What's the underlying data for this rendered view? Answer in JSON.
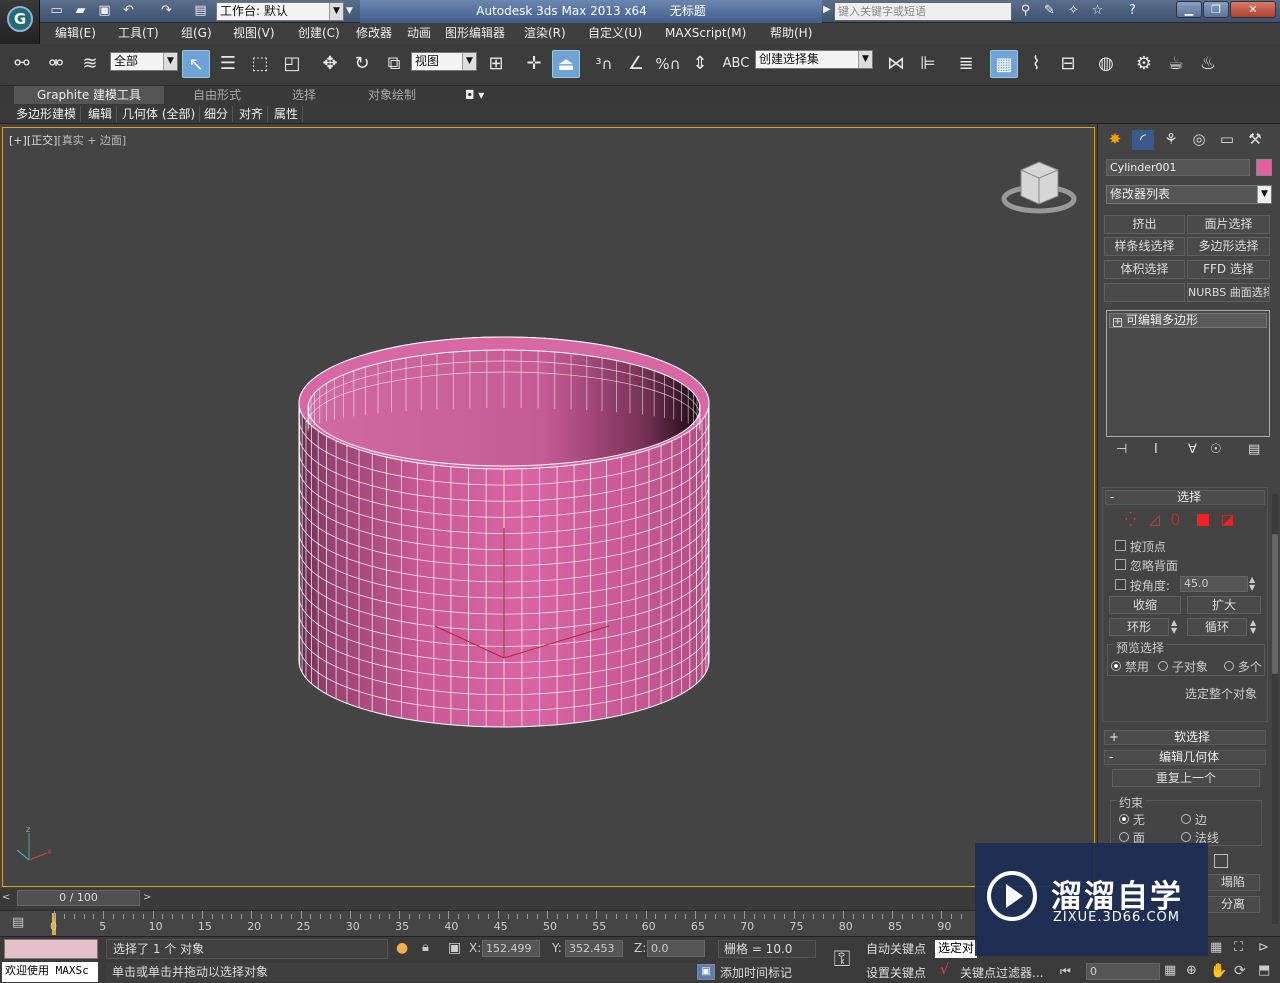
{
  "titlebar": {
    "workspace_label": "工作台: 默认",
    "app_title": "Autodesk 3ds Max  2013 x64",
    "doc_title": "无标题",
    "search_placeholder": "键入关键字或短语"
  },
  "menu": [
    "编辑(E)",
    "工具(T)",
    "组(G)",
    "视图(V)",
    "创建(C)",
    "修改器",
    "动画",
    "图形编辑器",
    "渲染(R)",
    "自定义(U)",
    "MAXScript(M)",
    "帮助(H)"
  ],
  "toolbar": {
    "filter_value": "全部",
    "refcoord_value": "视图",
    "selset_value": "创建选择集"
  },
  "ribbon": {
    "tabs": [
      "Graphite 建模工具",
      "自由形式",
      "选择",
      "对象绘制"
    ],
    "subtabs": [
      "多边形建模",
      "编辑",
      "几何体 (全部)",
      "细分",
      "对齐",
      "属性"
    ]
  },
  "viewport": {
    "label_a": "[+]",
    "label_b": "[正交]",
    "label_c": "[真实 + 边面]"
  },
  "command_panel": {
    "object_name": "Cylinder001",
    "object_color": "#e060a0",
    "modifier_list": "修改器列表",
    "mod_buttons": [
      "挤出",
      "面片选择",
      "样条线选择",
      "多边形选择",
      "体积选择",
      "FFD 选择",
      "",
      "NURBS 曲面选择"
    ],
    "stack_item": "可编辑多边形",
    "rollout_select": "选择",
    "by_vertex": "按顶点",
    "ignore_back": "忽略背面",
    "by_angle": "按角度:",
    "angle_value": "45.0",
    "shrink": "收缩",
    "grow": "扩大",
    "ring": "环形",
    "loop": "循环",
    "preview_title": "预览选择",
    "preview_off": "禁用",
    "preview_sub": "子对象",
    "preview_multi": "多个",
    "select_whole": "选定整个对象",
    "soft_select": "软选择",
    "edit_geom": "编辑几何体",
    "repeat_last": "重复上一个",
    "constraint_title": "约束",
    "c_none": "无",
    "c_edge": "边",
    "c_face": "面",
    "c_normal": "法线",
    "collapse": "塌陷",
    "detach": "分离"
  },
  "timeline": {
    "frame_label": "0 / 100",
    "ticks": [
      "0",
      "5",
      "10",
      "15",
      "20",
      "25",
      "30",
      "35",
      "40",
      "45",
      "50",
      "55",
      "60",
      "65",
      "70",
      "75",
      "80",
      "85",
      "90"
    ]
  },
  "status": {
    "welcome": "欢迎使用 MAXSc",
    "selected": "选择了 1 个 对象",
    "prompt": "单击或单击并拖动以选择对象",
    "x_label": "X:",
    "x_value": "152.499",
    "y_label": "Y:",
    "y_value": "352.453",
    "z_label": "Z:",
    "z_value": "0.0",
    "grid": "栅格 = 10.0",
    "add_time_tag": "添加时间标记",
    "auto_key": "自动关键点",
    "set_key": "设置关键点",
    "selected_obj": "选定对",
    "key_filter": "关键点过滤器...",
    "frame_value": "0"
  },
  "watermark": {
    "brand": "溜溜自学",
    "url": "ZIXUE.3D66.COM"
  }
}
